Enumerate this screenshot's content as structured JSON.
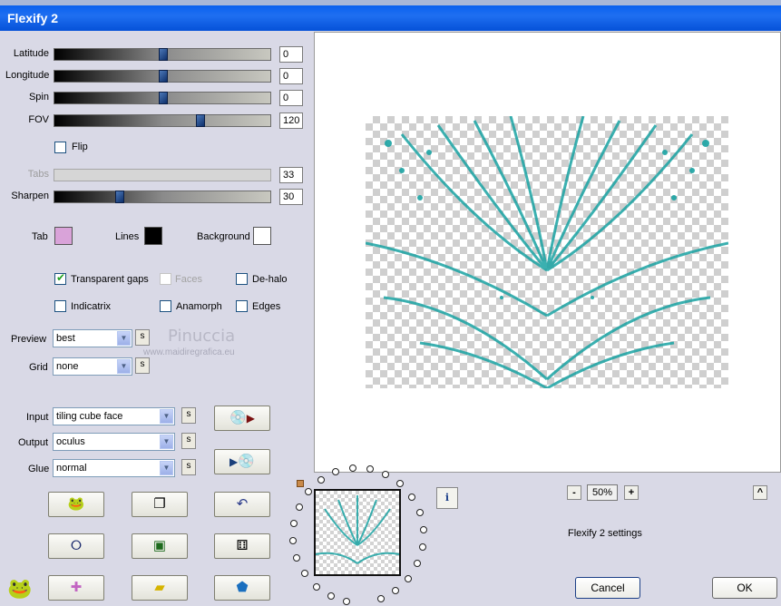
{
  "window": {
    "title": "Flexify 2"
  },
  "sliders": [
    {
      "label": "Latitude",
      "value": "0",
      "level": 0.5,
      "enabled": true
    },
    {
      "label": "Longitude",
      "value": "0",
      "level": 0.5,
      "enabled": true
    },
    {
      "label": "Spin",
      "value": "0",
      "level": 0.5,
      "enabled": true
    },
    {
      "label": "FOV",
      "value": "120",
      "level": 0.67,
      "enabled": true
    },
    {
      "label": "Tabs",
      "value": "33",
      "level": 0.33,
      "enabled": false
    },
    {
      "label": "Sharpen",
      "value": "30",
      "level": 0.3,
      "enabled": true
    }
  ],
  "flip_label": "Flip",
  "colors": {
    "tab_label": "Tab",
    "tab_color": "#d9a3d9",
    "lines_label": "Lines",
    "lines_color": "#000000",
    "background_label": "Background",
    "background_color": "#ffffff"
  },
  "checkboxes": {
    "transparent_gaps": {
      "label": "Transparent gaps",
      "checked": true
    },
    "faces": {
      "label": "Faces",
      "checked": false
    },
    "dehalo": {
      "label": "De-halo",
      "checked": false
    },
    "indicatrix": {
      "label": "Indicatrix",
      "checked": false
    },
    "anamorph": {
      "label": "Anamorph",
      "checked": false
    },
    "edges": {
      "label": "Edges",
      "checked": false
    }
  },
  "selects": {
    "preview": {
      "label": "Preview",
      "value": "best"
    },
    "grid": {
      "label": "Grid",
      "value": "none"
    },
    "input": {
      "label": "Input",
      "value": "tiling cube face"
    },
    "output": {
      "label": "Output",
      "value": "oculus"
    },
    "glue": {
      "label": "Glue",
      "value": "normal"
    }
  },
  "s_button_label": "s",
  "watermark": {
    "line1": "Pinuccia",
    "line2": "www.maidiregrafica.eu"
  },
  "zoom": {
    "minus": "-",
    "value": "50%",
    "plus": "+"
  },
  "settings_caption": "Flexify 2 settings",
  "buttons": {
    "cancel": "Cancel",
    "ok": "OK",
    "info": "i",
    "collapse": "^"
  },
  "icons": {
    "teal": "#1aa3a3"
  }
}
